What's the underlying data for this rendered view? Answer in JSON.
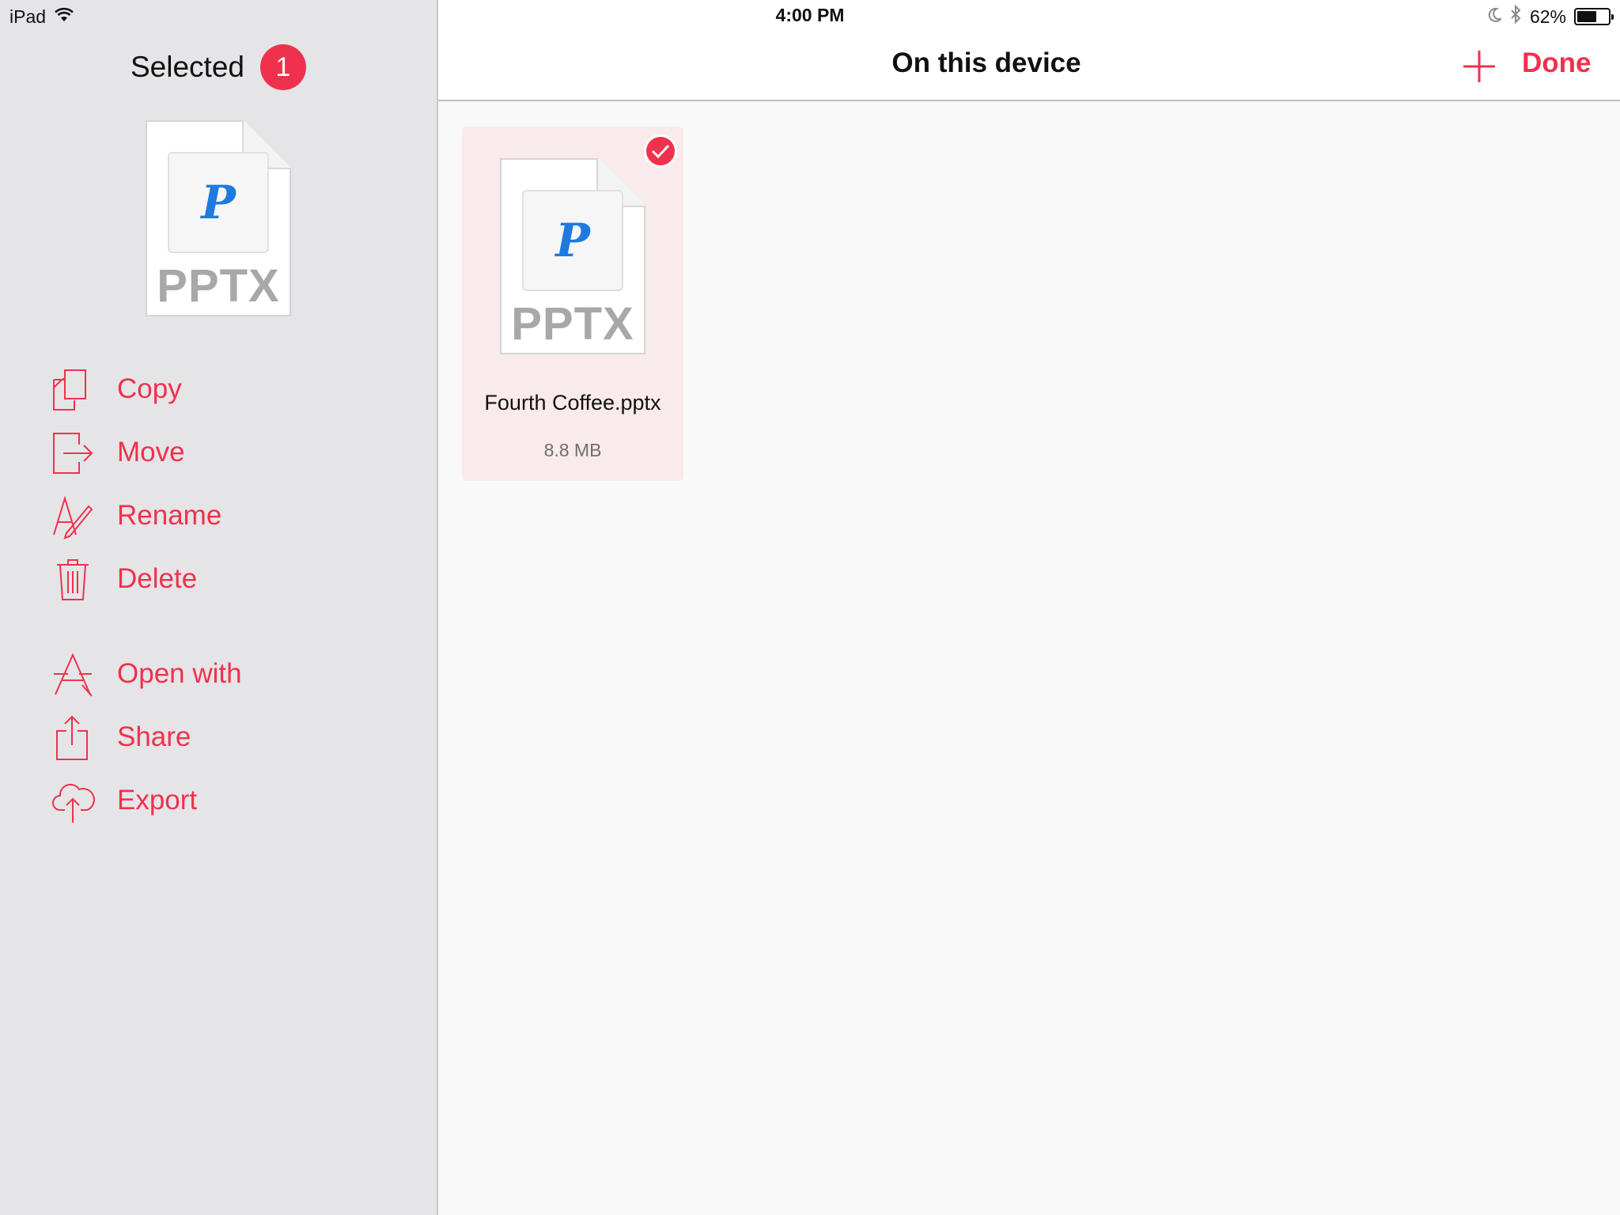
{
  "status_bar": {
    "device": "iPad",
    "time": "4:00 PM",
    "battery": "62%",
    "battery_level": 0.62
  },
  "sidebar": {
    "title": "Selected",
    "selected_count": "1",
    "preview": {
      "letter": "P",
      "extension": "PPTX"
    },
    "actions": [
      {
        "label": "Copy",
        "icon": "copy-icon"
      },
      {
        "label": "Move",
        "icon": "move-icon"
      },
      {
        "label": "Rename",
        "icon": "rename-icon"
      },
      {
        "label": "Delete",
        "icon": "trash-icon"
      },
      {
        "label": "Open with",
        "icon": "open-with-icon"
      },
      {
        "label": "Share",
        "icon": "share-icon"
      },
      {
        "label": "Export",
        "icon": "cloud-upload-icon"
      }
    ]
  },
  "navbar": {
    "title": "On this device",
    "add_icon": "plus-icon",
    "done_label": "Done"
  },
  "files": [
    {
      "name": "Fourth Coffee.pptx",
      "size": "8.8 MB",
      "letter": "P",
      "extension": "PPTX",
      "selected": true
    }
  ],
  "colors": {
    "accent": "#f0314d",
    "sidebar_bg": "#e5e5e8",
    "main_bg": "#f9f9f9",
    "selected_tile_bg": "#f9eaeb",
    "doc_letter": "#1f7ae0"
  }
}
